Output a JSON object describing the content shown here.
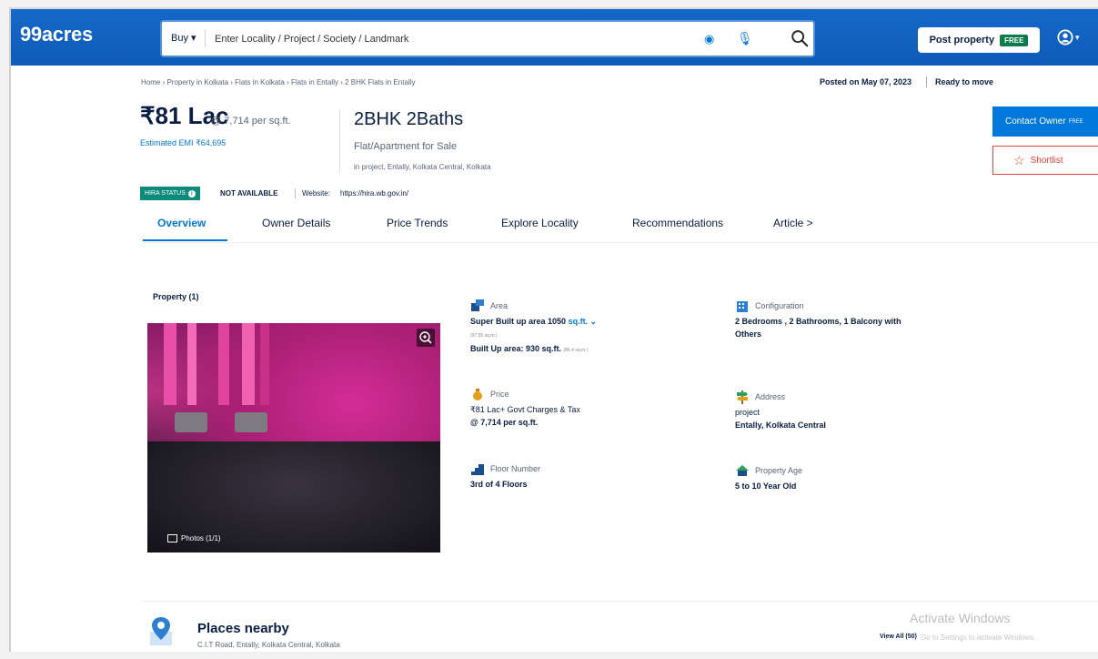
{
  "header": {
    "logo": "99acres",
    "buy_label": "Buy ▾",
    "search_placeholder": "Enter Locality / Project / Society / Landmark",
    "post_property_label": "Post property",
    "free_badge": "FREE"
  },
  "breadcrumb": "Home › Property in Kolkata › Flats in Kolkata › Flats in Entally › 2 BHK Flats in Entally",
  "posted": "Posted on May 07, 2023",
  "ready": "Ready to move",
  "listing": {
    "price": "₹81 Lac",
    "per_sqft": "@ 7,714 per sq.ft.",
    "emi": "Estimated EMI ₹64,695",
    "bhk": "2BHK 2Baths",
    "sale_type": "Flat/Apartment for Sale",
    "location": "in project, Entally, Kolkata Central, Kolkata"
  },
  "actions": {
    "contact_owner": "Contact Owner",
    "contact_badge": "FREE",
    "shortlist": "Shortlist"
  },
  "rera": {
    "badge": "HIRA STATUS",
    "status": "NOT AVAILABLE",
    "website_label": "Website:",
    "website": "https://hira.wb.gov.in/"
  },
  "tabs": [
    "Overview",
    "Owner Details",
    "Price Trends",
    "Explore Locality",
    "Recommendations",
    "Article >"
  ],
  "property": {
    "label": "Property (1)",
    "photos": "Photos (1/1)",
    "area": {
      "label": "Area",
      "super": "Super Built up area 1050",
      "unit": "sq.ft. ⌄",
      "super_sqm": "(97.55 sq.m.)",
      "built": "Built Up area: 930 sq.ft.",
      "built_sqm": "(86.4 sq.m.)"
    },
    "configuration": {
      "label": "Configuration",
      "value_1": "2 Bedrooms , 2 Bathrooms, 1 Balcony with",
      "value_2": "Others"
    },
    "price": {
      "label": "Price",
      "value_1": "₹81 Lac+ Govt Charges & Tax",
      "value_2": "@ 7,714 per sq.ft."
    },
    "address": {
      "label": "Address",
      "value_1": "project",
      "value_2": "Entally, Kolkata Central"
    },
    "floor": {
      "label": "Floor Number",
      "value": "3rd of 4 Floors"
    },
    "age": {
      "label": "Property Age",
      "value": "5 to 10 Year Old"
    }
  },
  "places": {
    "title": "Places nearby",
    "subtitle": "C.I.T Road, Entally, Kolkata Central, Kolkata",
    "view_all": "View All (50)"
  },
  "watermark": {
    "title": "Activate Windows",
    "subtitle": "Go to Settings to activate Windows."
  },
  "colors": {
    "brand_blue": "#0e5bb8",
    "link_blue": "#0078db",
    "shortlist_red": "#e4443a",
    "rera_teal": "#0e8a7a"
  }
}
